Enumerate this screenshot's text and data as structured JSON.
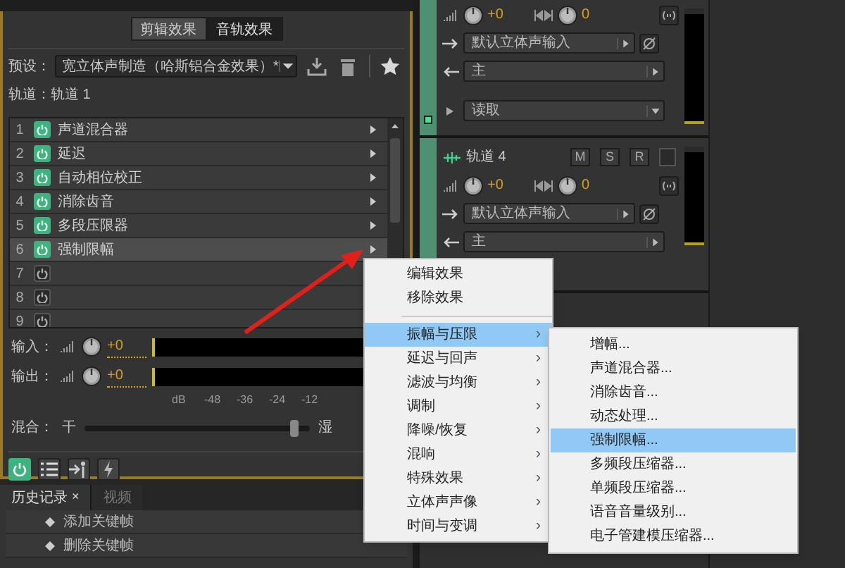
{
  "effects_panel": {
    "clip_tabs": [
      {
        "label": "剪辑效果",
        "selected": false
      },
      {
        "label": "音轨效果",
        "selected": true
      }
    ],
    "preset": {
      "label": "预设：",
      "value": "宽立体声制造（哈斯铝合金效果）*"
    },
    "track_label": "轨道：轨道 1",
    "effects": [
      {
        "number": "1",
        "name": "声道混合器",
        "on": true,
        "selected": false
      },
      {
        "number": "2",
        "name": "延迟",
        "on": true,
        "selected": false
      },
      {
        "number": "3",
        "name": "自动相位校正",
        "on": true,
        "selected": false
      },
      {
        "number": "4",
        "name": "消除齿音",
        "on": true,
        "selected": false
      },
      {
        "number": "5",
        "name": "多段压限器",
        "on": true,
        "selected": false
      },
      {
        "number": "6",
        "name": "强制限幅",
        "on": true,
        "selected": true
      },
      {
        "number": "7",
        "on": false,
        "selected": false
      },
      {
        "number": "8",
        "on": false,
        "selected": false
      },
      {
        "number": "9",
        "on": false,
        "selected": false
      }
    ],
    "input": {
      "label": "输入：",
      "value": "+0"
    },
    "output": {
      "label": "输出：",
      "value": "+0"
    },
    "meter_scale": [
      "dB",
      "-48",
      "-36",
      "-24",
      "-12"
    ],
    "mix": {
      "label": "混合：",
      "dry": "干",
      "wet": "湿",
      "level": 0.93
    },
    "power_on": true
  },
  "history": {
    "tabs": [
      {
        "label": "历史记录",
        "selected": true
      },
      {
        "label": "视频",
        "selected": false
      }
    ],
    "close": "×",
    "items": [
      "添加关键帧",
      "删除关键帧"
    ]
  },
  "tracks": [
    {
      "volume": "+0",
      "pan": "0",
      "input": "默认立体声输入",
      "output": "主",
      "automation": "读取"
    },
    {
      "name": "轨道 4",
      "buttons": [
        "M",
        "S",
        "R"
      ],
      "volume": "+0",
      "pan": "0",
      "input": "默认立体声输入",
      "output": "主"
    }
  ],
  "context_menu": {
    "items": [
      {
        "label": "编辑效果",
        "kind": "action",
        "selected": false
      },
      {
        "label": "移除效果",
        "kind": "action",
        "selected": false
      },
      {
        "kind": "separator"
      },
      {
        "label": "振幅与压限",
        "kind": "submenu",
        "selected": true
      },
      {
        "label": "延迟与回声",
        "kind": "submenu",
        "selected": false
      },
      {
        "label": "滤波与均衡",
        "kind": "submenu",
        "selected": false
      },
      {
        "label": "调制",
        "kind": "submenu",
        "selected": false
      },
      {
        "label": "降噪/恢复",
        "kind": "submenu",
        "selected": false
      },
      {
        "label": "混响",
        "kind": "submenu",
        "selected": false
      },
      {
        "label": "特殊效果",
        "kind": "submenu",
        "selected": false
      },
      {
        "label": "立体声声像",
        "kind": "submenu",
        "selected": false
      },
      {
        "label": "时间与变调",
        "kind": "submenu",
        "selected": false
      }
    ],
    "arrow": "›"
  },
  "submenu": {
    "items": [
      {
        "label": "增幅...",
        "selected": false
      },
      {
        "label": "声道混合器...",
        "selected": false
      },
      {
        "label": "消除齿音...",
        "selected": false
      },
      {
        "label": "动态处理...",
        "selected": false
      },
      {
        "label": "强制限幅...",
        "selected": true
      },
      {
        "label": "多频段压缩器...",
        "selected": false
      },
      {
        "label": "单频段压缩器...",
        "selected": false
      },
      {
        "label": "语音音量级别...",
        "selected": false
      },
      {
        "label": "电子管建模压缩器...",
        "selected": false
      }
    ]
  }
}
